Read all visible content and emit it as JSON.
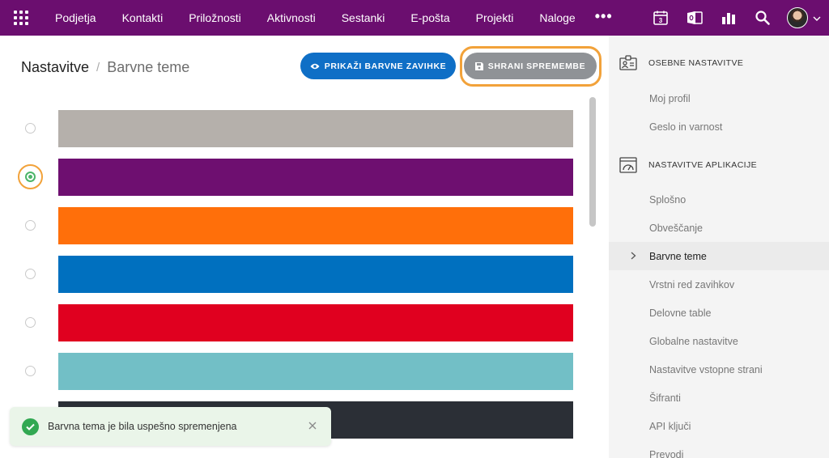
{
  "topbar": {
    "apps_icon": "grid-icon",
    "nav": [
      "Podjetja",
      "Kontakti",
      "Priložnosti",
      "Aktivnosti",
      "Sestanki",
      "E-pošta",
      "Projekti",
      "Naloge"
    ],
    "more_label": "•••",
    "calendar_day": "3",
    "icons": [
      "calendar-icon",
      "outlook-icon",
      "reports-icon",
      "search-icon",
      "avatar",
      "chevron-down-icon"
    ]
  },
  "breadcrumb": {
    "root": "Nastavitve",
    "separator": "/",
    "current": "Barvne teme"
  },
  "actions": {
    "show_tabs_label": "PRIKAŽI BARVNE ZAVIHKE",
    "save_label": "SHRANI SPREMEMBE"
  },
  "themes": [
    {
      "color": "#b5b0ab",
      "selected": false
    },
    {
      "color": "#6e0f70",
      "selected": true
    },
    {
      "color": "#ff6f0a",
      "selected": false
    },
    {
      "color": "#0070bf",
      "selected": false
    },
    {
      "color": "#e0001f",
      "selected": false
    },
    {
      "color": "#72bfc6",
      "selected": false
    },
    {
      "color": "#2b2f36",
      "selected": false
    }
  ],
  "toast": {
    "message": "Barvna tema je bila uspešno spremenjena"
  },
  "sidebar": {
    "personal_title": "OSEBNE NASTAVITVE",
    "personal_items": [
      "Moj profil",
      "Geslo in varnost"
    ],
    "app_title": "NASTAVITVE APLIKACIJE",
    "app_items": [
      "Splošno",
      "Obveščanje",
      "Barvne teme",
      "Vrstni red zavihkov",
      "Delovne table",
      "Globalne nastavitve",
      "Nastavitve vstopne strani",
      "Šifranti",
      "API ključi",
      "Prevodi"
    ],
    "active_item": "Barvne teme"
  },
  "colors": {
    "topbar": "#6b0e6f",
    "primary_button": "#0f6fc6",
    "save_button": "#8f9296",
    "highlight": "#f2a23a",
    "success": "#32a852"
  }
}
